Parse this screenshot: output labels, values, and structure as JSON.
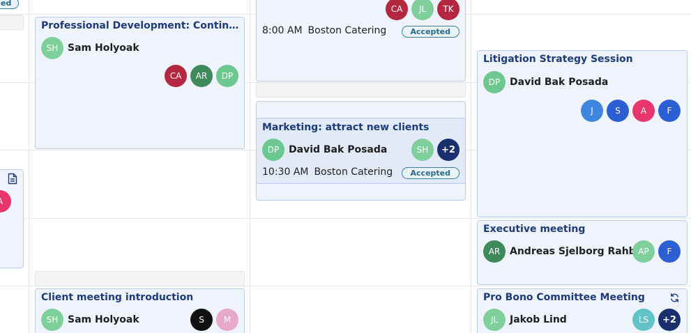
{
  "colors": {
    "card_bg": "#eef3fc",
    "card_border": "#b9cbe9",
    "title": "#1d3b7a",
    "accepted": "#3b7ea0"
  },
  "left_partial": {
    "top_badge": "ed",
    "avatar": {
      "initials": "A",
      "color": "#e8356d"
    },
    "icon": "document-icon"
  },
  "event_prof_dev": {
    "title": "Professional Development: Continuing Legal …",
    "organizer": {
      "initials": "SH",
      "name": "Sam Holyoak",
      "color": "#7fcf9b"
    },
    "attendees": [
      {
        "initials": "CA",
        "color": "#b5263f"
      },
      {
        "initials": "AR",
        "color": "#3e8a5b"
      },
      {
        "initials": "DP",
        "color": "#6cc88e"
      }
    ]
  },
  "event_catering_top": {
    "attendees": [
      {
        "initials": "CA",
        "color": "#b5263f"
      },
      {
        "initials": "JL",
        "color": "#7fcf9b"
      },
      {
        "initials": "TK",
        "color": "#b5263f"
      }
    ],
    "time": "8:00 AM",
    "location": "Boston Catering",
    "status": "Accepted"
  },
  "event_marketing": {
    "title": "Marketing: attract new clients",
    "organizer": {
      "initials": "DP",
      "name": "David Bak Posada",
      "color": "#6cc88e"
    },
    "attendees": [
      {
        "initials": "SH",
        "color": "#7fcf9b"
      },
      {
        "initials": "+2",
        "color": "#1a2f6e"
      }
    ],
    "time": "10:30 AM",
    "location": "Boston Catering",
    "status": "Accepted"
  },
  "event_litigation": {
    "title": "Litigation Strategy Session",
    "organizer": {
      "initials": "DP",
      "name": "David Bak Posada",
      "color": "#6cc88e"
    },
    "attendees": [
      {
        "initials": "J",
        "color": "#3f86e0"
      },
      {
        "initials": "S",
        "color": "#2d5fd4"
      },
      {
        "initials": "A",
        "color": "#e8356d"
      },
      {
        "initials": "F",
        "color": "#2d5fd4"
      }
    ]
  },
  "event_executive": {
    "title": "Executive meeting",
    "organizer": {
      "initials": "AR",
      "name": "Andreas Sjelborg Rahbek",
      "color": "#3e8a5b"
    },
    "attendees": [
      {
        "initials": "AP",
        "color": "#7fcf9b"
      },
      {
        "initials": "F",
        "color": "#2d5fd4"
      }
    ]
  },
  "event_client": {
    "title": "Client meeting introduction",
    "organizer": {
      "initials": "SH",
      "name": "Sam Holyoak",
      "color": "#7fcf9b"
    },
    "attendees": [
      {
        "initials": "S",
        "color": "#111111"
      },
      {
        "initials": "M",
        "color": "#e8a8c8"
      }
    ]
  },
  "event_probono": {
    "title": "Pro Bono Committee Meeting",
    "icon": "recurring-icon",
    "organizer": {
      "initials": "JL",
      "name": "Jakob Lind",
      "color": "#7fcf9b"
    },
    "attendees": [
      {
        "initials": "LS",
        "color": "#62c3c9"
      },
      {
        "initials": "+2",
        "color": "#1a2f6e"
      }
    ]
  }
}
